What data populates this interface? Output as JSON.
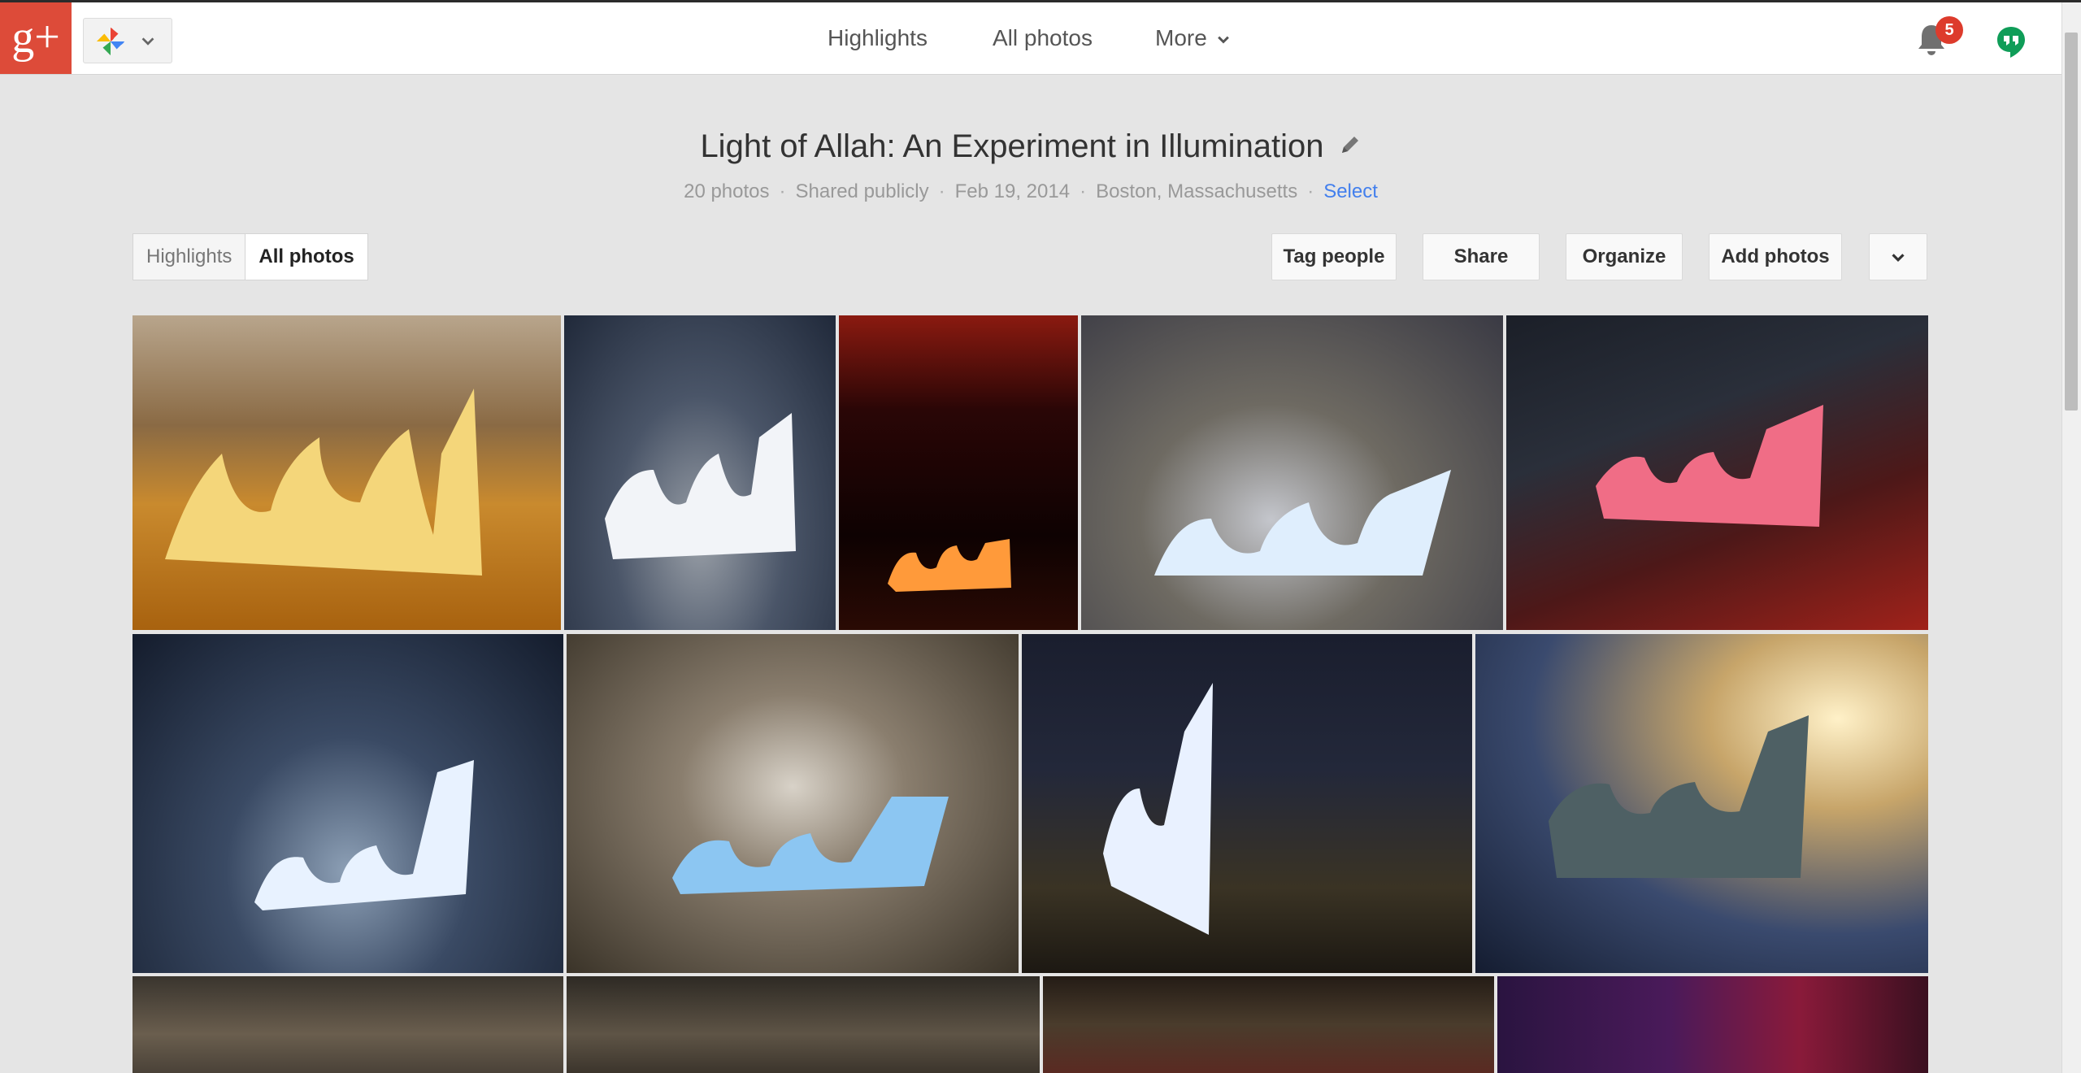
{
  "app": {
    "logo_text": "g+",
    "nav": {
      "highlights": "Highlights",
      "all_photos": "All photos",
      "more": "More"
    },
    "notifications_count": "5"
  },
  "album": {
    "title": "Light of Allah: An Experiment in Illumination",
    "photo_count": "20 photos",
    "visibility": "Shared publicly",
    "date": "Feb 19, 2014",
    "location": "Boston, Massachusetts",
    "select_label": "Select"
  },
  "view_toggle": {
    "highlights": "Highlights",
    "all_photos": "All photos",
    "selected": "All photos"
  },
  "actions": {
    "tag_people": "Tag people",
    "share": "Share",
    "organize": "Organize",
    "add_photos": "Add photos"
  },
  "colors": {
    "brand_red": "#dd4b39",
    "link_blue": "#427fed",
    "badge_red": "#dd3b2c",
    "hangouts_green": "#0f9d58"
  },
  "icons": [
    "photos-pinwheel-icon",
    "chevron-down-icon",
    "bell-icon",
    "hangouts-icon",
    "pencil-icon"
  ]
}
